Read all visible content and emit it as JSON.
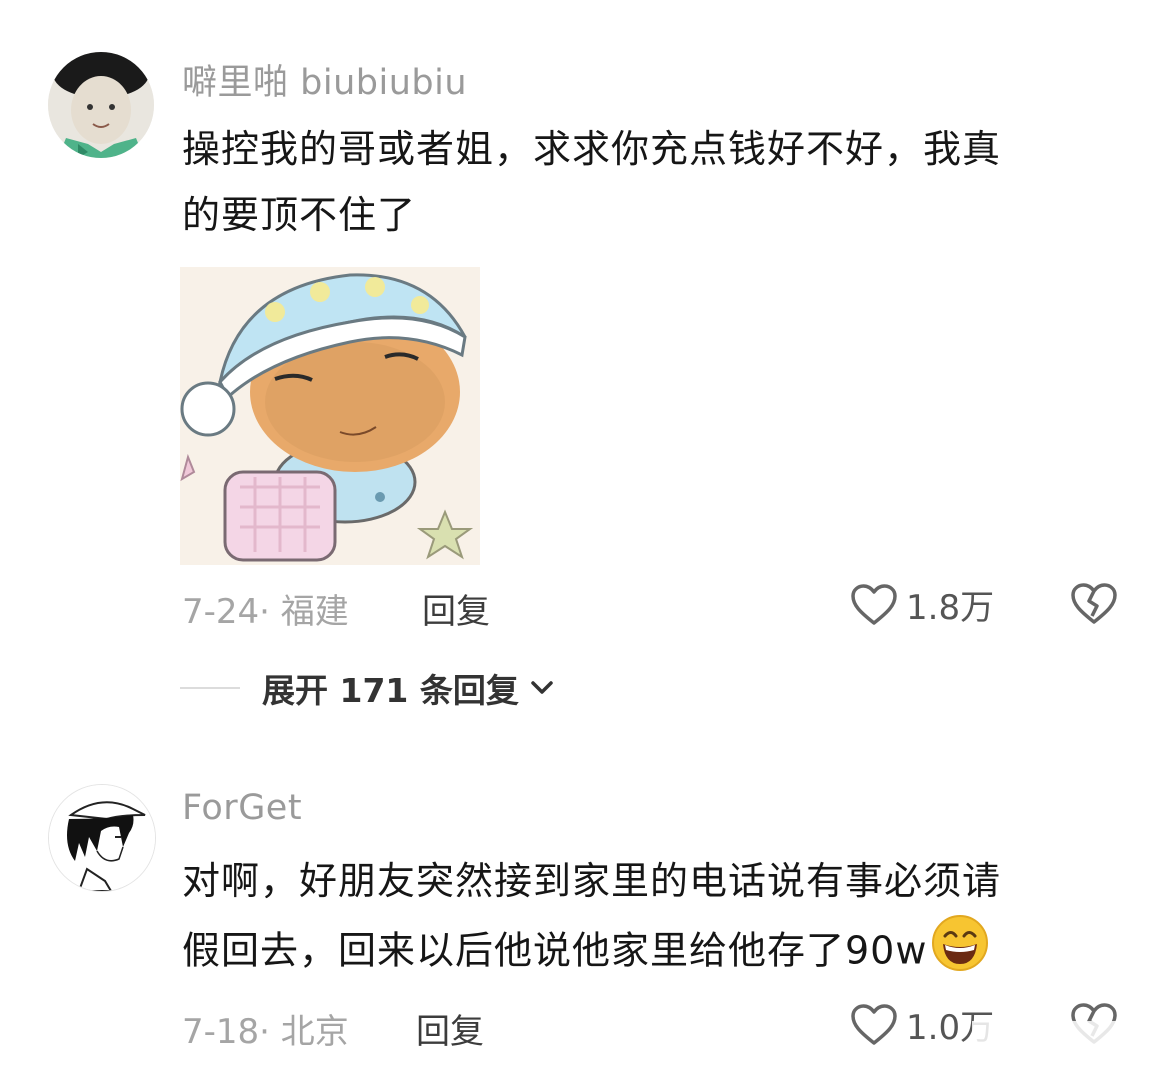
{
  "comments": [
    {
      "username": "噼里啪 biubiubiu",
      "text_line1": "操控我的哥或者姐，求求你充点钱好不好，我真",
      "text_line2": "的要顶不住了",
      "date_location": "7-24· 福建",
      "reply_label": "回复",
      "like_count": "1.8万",
      "expand_label": "展开 171 条回复"
    },
    {
      "username": "ForGet",
      "text_line1": "对啊，好朋友突然接到家里的电话说有事必须请",
      "text_line2": "假回去，回来以后他说他家里给他存了90w",
      "date_location": "7-18· 北京",
      "reply_label": "回复",
      "like_count": "1.0万"
    }
  ],
  "icons": {
    "like": "heart-outline-icon",
    "dislike": "broken-heart-icon",
    "expand": "chevron-down-icon",
    "emoji": "grinning-face-emoji"
  },
  "colors": {
    "username": "#9a9a9a",
    "text": "#161616",
    "meta": "#a5a5a5",
    "reply": "#3c3c3c"
  }
}
